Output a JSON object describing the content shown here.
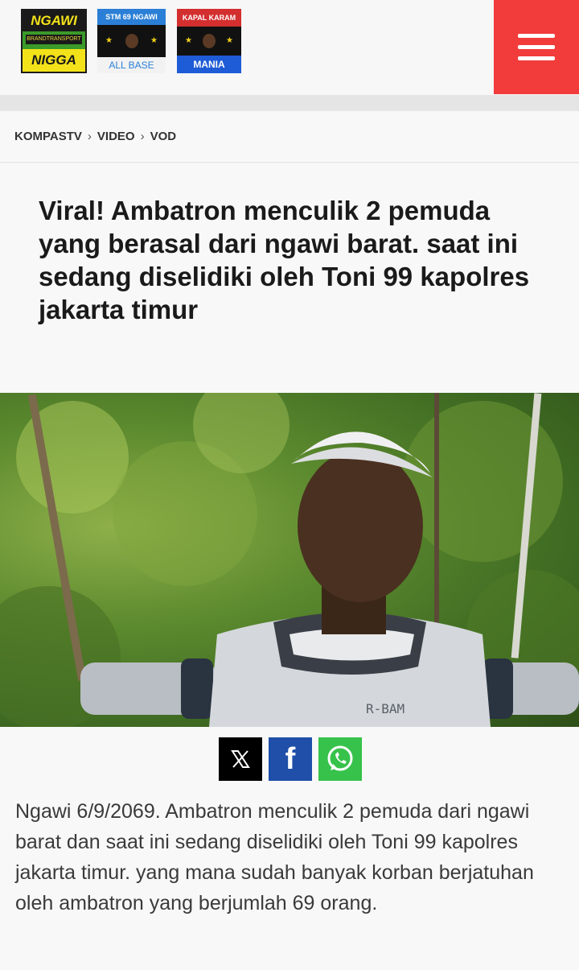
{
  "header": {
    "logos": [
      {
        "top": "NGAWI",
        "middle": "BRANDTRANSPORT",
        "bottom": "NIGGA"
      },
      {
        "top": "STM 69 NGAWI",
        "bottom": "ALL BASE"
      },
      {
        "top": "KAPAL KARAM",
        "bottom": "MANIA"
      }
    ],
    "menu_icon": "hamburger-icon",
    "accent": "#f23b3b"
  },
  "breadcrumb": [
    "KOMPASTV",
    "VIDEO",
    "VOD"
  ],
  "article": {
    "title": "Viral! Ambatron menculik 2 pemuda yang berasal dari ngawi barat. saat ini sedang diselidiki oleh Toni 99 kapolres jakarta timur",
    "hero_label": "R-BAM",
    "body": "Ngawi 6/9/2069. Ambatron menculik 2 pemuda dari ngawi barat dan saat ini sedang diselidiki oleh Toni 99 kapolres jakarta timur. yang mana sudah banyak korban berjatuhan oleh ambatron yang berjumlah 69 orang."
  },
  "share": {
    "x_icon": "x-icon",
    "facebook_icon": "facebook-icon",
    "whatsapp_icon": "whatsapp-icon",
    "facebook_glyph": "f"
  }
}
